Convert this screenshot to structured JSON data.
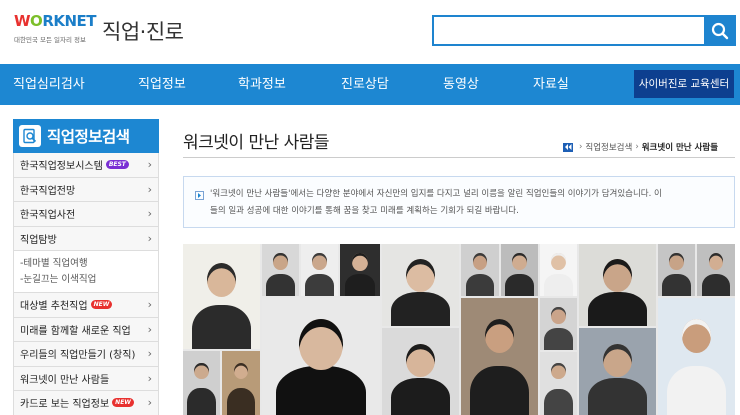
{
  "header": {
    "logo_text_w": "W",
    "logo_text_o": "O",
    "logo_text_rest": "RKNET",
    "logo_tagline": "대한민국 모든 일자리 정보",
    "section_title": "직업·진로",
    "search_placeholder": ""
  },
  "nav": {
    "items": [
      "직업심리검사",
      "직업정보",
      "학과정보",
      "진로상담",
      "동영상",
      "자료실"
    ],
    "cyber_button": "사이버진로 교육센터"
  },
  "sidebar": {
    "title": "직업정보검색",
    "items": [
      {
        "label": "한국직업정보시스템",
        "badge": "BEST"
      },
      {
        "label": "한국직업전망"
      },
      {
        "label": "한국직업사전"
      },
      {
        "label": "직업탐방"
      }
    ],
    "subitems": [
      "-테마별 직업여행",
      "-눈길끄는 이색직업"
    ],
    "items2": [
      {
        "label": "대상별 추천직업",
        "badge": "NEW"
      },
      {
        "label": "미래를 함께할 새로운 직업"
      },
      {
        "label": "우리들의 직업만들기 (창직)"
      },
      {
        "label": "워크넷이 만난 사람들"
      },
      {
        "label": "카드로 보는 직업정보",
        "badge": "NEW"
      }
    ]
  },
  "main": {
    "page_title": "워크넷이 만난 사람들",
    "breadcrumb": [
      "직업정보검색",
      "워크넷이 만난 사람들"
    ],
    "intro_line1": "'워크넷이 만난 사람들'에서는 다양한 분야에서 자신만의 입지를 다지고 널리 이름을 알린 직업인들의 이야기가 담겨있습니다. 이",
    "intro_line2": "들의 일과 성공에 대한 이야기를 통해 꿈을 찾고 미래를 계획하는 기회가 되길 바랍니다."
  },
  "colors": {
    "primary": "#1d87d2",
    "dark_button": "#0d3f8f",
    "badge_best": "#7a2fd4",
    "badge_new": "#e8312f"
  }
}
